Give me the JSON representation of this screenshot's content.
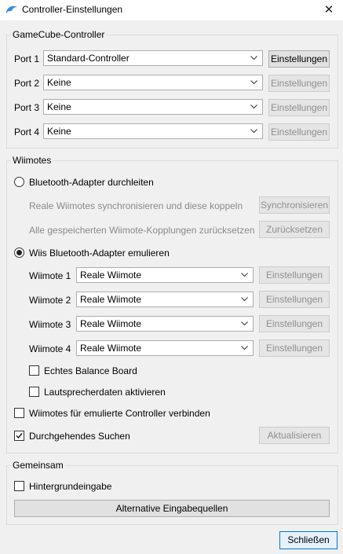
{
  "window": {
    "title": "Controller-Einstellungen",
    "close_glyph": "✕",
    "icon": "dolphin-icon"
  },
  "gamecube": {
    "title": "GameCube-Controller",
    "ports": [
      {
        "label": "Port 1",
        "value": "Standard-Controller",
        "button": "Einstellungen",
        "button_enabled": true
      },
      {
        "label": "Port 2",
        "value": "Keine",
        "button": "Einstellungen",
        "button_enabled": false
      },
      {
        "label": "Port 3",
        "value": "Keine",
        "button": "Einstellungen",
        "button_enabled": false
      },
      {
        "label": "Port 4",
        "value": "Keine",
        "button": "Einstellungen",
        "button_enabled": false
      }
    ]
  },
  "wiimotes": {
    "title": "Wiimotes",
    "passthrough_label": "Bluetooth-Adapter durchleiten",
    "passthrough_selected": false,
    "sync_label": "Reale Wiimotes synchronisieren und diese koppeln",
    "sync_button": "Synchronisieren",
    "reset_label": "Alle gespeicherten Wiimote-Kopplungen zurücksetzen",
    "reset_button": "Zurücksetzen",
    "emulate_label": "Wiis Bluetooth-Adapter emulieren",
    "emulate_selected": true,
    "slots": [
      {
        "label": "Wiimote 1",
        "value": "Reale Wiimote",
        "button": "Einstellungen"
      },
      {
        "label": "Wiimote 2",
        "value": "Reale Wiimote",
        "button": "Einstellungen"
      },
      {
        "label": "Wiimote 3",
        "value": "Reale Wiimote",
        "button": "Einstellungen"
      },
      {
        "label": "Wiimote 4",
        "value": "Reale Wiimote",
        "button": "Einstellungen"
      }
    ],
    "balance_board_label": "Echtes Balance Board",
    "balance_board_checked": false,
    "speaker_label": "Lautsprecherdaten aktivieren",
    "speaker_checked": false,
    "connect_emulated_label": "Wiimotes für emulierte Controller verbinden",
    "connect_emulated_checked": false,
    "continuous_scan_label": "Durchgehendes Suchen",
    "continuous_scan_checked": true,
    "refresh_button": "Aktualisieren"
  },
  "common": {
    "title": "Gemeinsam",
    "background_input_label": "Hintergrundeingabe",
    "background_input_checked": false,
    "alt_sources_button": "Alternative Eingabequellen"
  },
  "footer": {
    "close_button": "Schließen"
  },
  "colors": {
    "accent": "#0078d7",
    "disabled_text": "#8a8a8a",
    "icon_blue": "#3a8fd6"
  }
}
